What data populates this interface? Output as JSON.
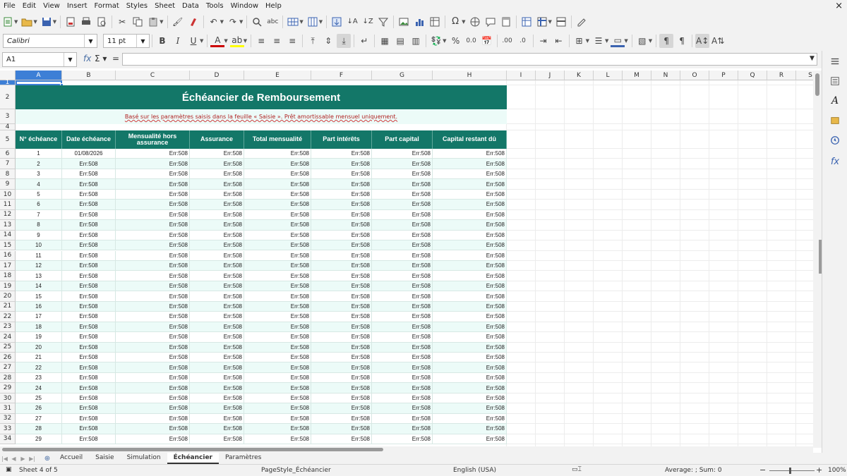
{
  "menu": [
    "File",
    "Edit",
    "View",
    "Insert",
    "Format",
    "Styles",
    "Sheet",
    "Data",
    "Tools",
    "Window",
    "Help"
  ],
  "window_close": "×",
  "font": {
    "name": "Calibri",
    "size": "11 pt"
  },
  "formula_bar": {
    "cell_ref": "A1",
    "value": ""
  },
  "columns": [
    {
      "id": "A",
      "w": 66
    },
    {
      "id": "B",
      "w": 76
    },
    {
      "id": "C",
      "w": 105
    },
    {
      "id": "D",
      "w": 77
    },
    {
      "id": "E",
      "w": 95
    },
    {
      "id": "F",
      "w": 86
    },
    {
      "id": "G",
      "w": 86
    },
    {
      "id": "H",
      "w": 105
    },
    {
      "id": "I",
      "w": 41
    },
    {
      "id": "J",
      "w": 41
    },
    {
      "id": "K",
      "w": 41
    },
    {
      "id": "L",
      "w": 41
    },
    {
      "id": "M",
      "w": 41
    },
    {
      "id": "N",
      "w": 41
    },
    {
      "id": "O",
      "w": 41
    },
    {
      "id": "P",
      "w": 41
    },
    {
      "id": "Q",
      "w": 41
    },
    {
      "id": "R",
      "w": 41
    },
    {
      "id": "S",
      "w": 41
    }
  ],
  "sheet": {
    "title": "Échéancier de Remboursement",
    "subtitle": "Basé sur les paramètres saisis dans la feuille « Saisie ». Prêt amortissable mensuel uniquement.",
    "headers": [
      "N° échéance",
      "Date échéance",
      "Mensualité hors assurance",
      "Assurance",
      "Total mensualité",
      "Part intérêts",
      "Part capital",
      "Capital restant dû"
    ],
    "first_date": "01/08/2026",
    "error": "Err:508",
    "installments": [
      1,
      2,
      3,
      4,
      5,
      6,
      7,
      8,
      9,
      10,
      11,
      12,
      13,
      14,
      15,
      16,
      17,
      18,
      19,
      20,
      21,
      22,
      23,
      24,
      25,
      26,
      27,
      28,
      29
    ]
  },
  "row_numbers": [
    1,
    2,
    3,
    4,
    5,
    6,
    7,
    8,
    9,
    10,
    11,
    12,
    13,
    14,
    15,
    16,
    17,
    18,
    19,
    20,
    21,
    22,
    23,
    24,
    25,
    26,
    27,
    28,
    29,
    30,
    31,
    32,
    33,
    34
  ],
  "tabs": [
    "Accueil",
    "Saisie",
    "Simulation",
    "Échéancier",
    "Paramètres"
  ],
  "active_tab": "Échéancier",
  "status": {
    "sheet": "Sheet 4 of 5",
    "page_style": "PageStyle_Échéancier",
    "language": "English (USA)",
    "summary": "Average: ; Sum: 0",
    "zoom": "100%"
  },
  "colors": {
    "header_teal": "#137768",
    "band_light": "#ecfbf8",
    "selection_blue": "#3d7fd6"
  }
}
